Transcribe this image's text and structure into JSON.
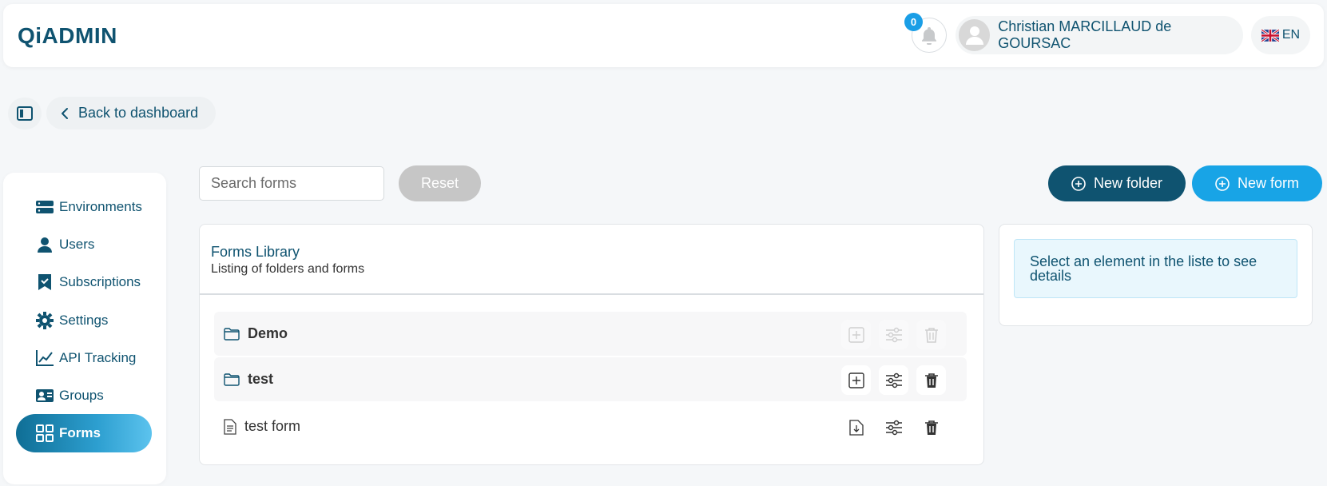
{
  "header": {
    "logo_text": "QiADMIN",
    "notifications_count": "0",
    "user_name": "Christian MARCILLAUD de GOURSAC",
    "language": "EN"
  },
  "toolbar": {
    "back_label": "Back to dashboard"
  },
  "sidebar": {
    "items": [
      {
        "label": "Environments",
        "icon": "server-icon"
      },
      {
        "label": "Users",
        "icon": "user-icon"
      },
      {
        "label": "Subscriptions",
        "icon": "bookmark-check-icon"
      },
      {
        "label": "Settings",
        "icon": "gear-icon"
      },
      {
        "label": "API Tracking",
        "icon": "trend-chart-icon"
      },
      {
        "label": "Groups",
        "icon": "id-card-icon"
      },
      {
        "label": "Forms",
        "icon": "grid-icon",
        "active": true
      }
    ]
  },
  "search": {
    "placeholder": "Search forms",
    "value": "",
    "reset_label": "Reset"
  },
  "actions": {
    "new_folder_label": "New folder",
    "new_form_label": "New form"
  },
  "library": {
    "title": "Forms Library",
    "subtitle": "Listing of folders and forms",
    "rows": [
      {
        "type": "folder",
        "label": "Demo",
        "actions_enabled": false
      },
      {
        "type": "folder",
        "label": "test",
        "actions_enabled": true
      },
      {
        "type": "form",
        "label": "test form",
        "actions_enabled": true
      }
    ]
  },
  "details": {
    "info_text": "Select an element in the liste to see details"
  },
  "colors": {
    "primary": "#0f5370",
    "accent": "#18a4e6",
    "disabled": "#c6c6c6"
  }
}
